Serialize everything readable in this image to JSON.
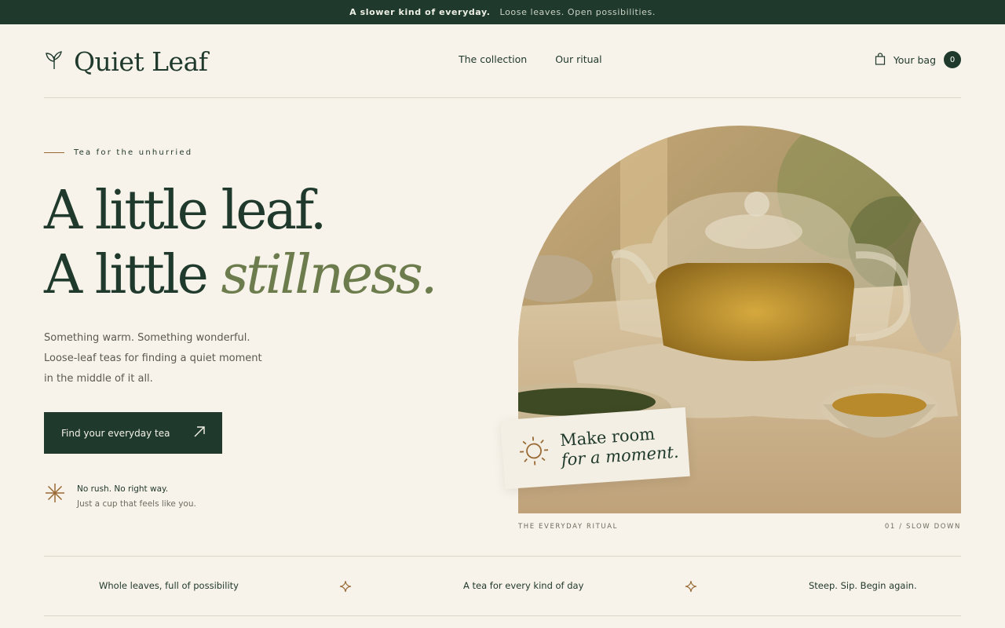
{
  "announcement": {
    "strong": "A slower kind of everyday.",
    "soft": "Loose leaves. Open possibilities."
  },
  "brand": {
    "name": "Quiet Leaf",
    "icon": "leaf-icon"
  },
  "nav": {
    "items": [
      "The collection",
      "Our ritual"
    ]
  },
  "bag": {
    "label": "Your bag",
    "count": "0",
    "icon": "bag-icon"
  },
  "hero": {
    "eyebrow": "Tea for the unhurried",
    "headline_line1": "A little leaf.",
    "headline_line2_prefix": "A little ",
    "headline_line2_emphasis": "stillness.",
    "body": [
      "Something warm. Something wonderful.",
      "Loose-leaf teas for finding a quiet moment",
      "in the middle of it all."
    ],
    "cta_label": "Find your everyday tea",
    "cta_icon": "arrow-up-right-icon",
    "note_title": "No rush. No right way.",
    "note_subtitle": "Just a cup that feels like you.",
    "note_icon": "asterisk-icon"
  },
  "image_badge": {
    "line1": "Make room",
    "line2": "for a moment.",
    "icon": "sun-icon"
  },
  "image_captions": {
    "left": "THE EVERYDAY RITUAL",
    "right": "01 / SLOW DOWN"
  },
  "strip": {
    "items": [
      "Whole leaves, full of possibility",
      "A tea for every kind of day",
      "Steep. Sip. Begin again."
    ],
    "separator_icon": "sparkle-icon"
  },
  "colors": {
    "background": "#f7f3ea",
    "forest": "#1f3a2c",
    "olive": "#6c7c4c",
    "copper": "#9a6a35"
  }
}
